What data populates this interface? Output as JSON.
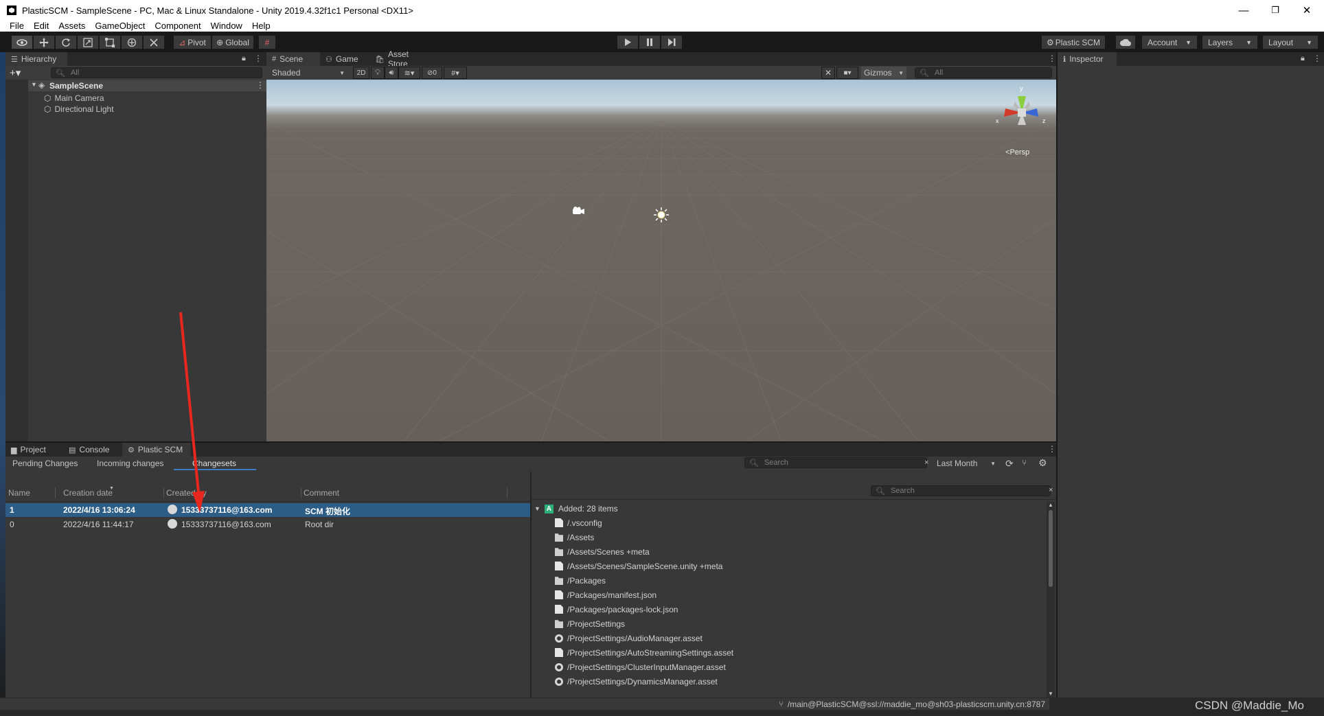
{
  "window": {
    "title": "PlasticSCM - SampleScene - PC, Mac & Linux Standalone - Unity 2019.4.32f1c1 Personal <DX11>",
    "minimize": "—",
    "maximize": "❐",
    "close": "✕"
  },
  "menu": [
    "File",
    "Edit",
    "Assets",
    "GameObject",
    "Component",
    "Window",
    "Help"
  ],
  "toolbar": {
    "pivot": "Pivot",
    "global": "Global",
    "plastic_scm": "Plastic SCM",
    "account": "Account",
    "layers": "Layers",
    "layout": "Layout"
  },
  "hierarchy": {
    "tab": "Hierarchy",
    "search_placeholder": "All",
    "scene": "SampleScene",
    "items": [
      "Main Camera",
      "Directional Light"
    ]
  },
  "scene_view": {
    "tabs": [
      "Scene",
      "Game",
      "Asset Store"
    ],
    "shading": "Shaded",
    "mode_2d": "2D",
    "hidden_count": "0",
    "gizmos": "Gizmos",
    "search_placeholder": "All",
    "persp": "Persp",
    "axes": {
      "x": "x",
      "y": "y",
      "z": "z"
    }
  },
  "inspector": {
    "tab": "Inspector"
  },
  "bottom": {
    "tabs": [
      "Project",
      "Console",
      "Plastic SCM"
    ],
    "subtabs": [
      "Pending Changes",
      "Incoming changes",
      "Changesets"
    ],
    "search_placeholder": "Search",
    "period": "Last Month",
    "columns": [
      "Name",
      "Creation date",
      "Created by",
      "Comment"
    ],
    "changesets": [
      {
        "name": "1",
        "date": "2022/4/16 13:06:24",
        "by": "15333737116@163.com",
        "comment": "SCM 初始化"
      },
      {
        "name": "0",
        "date": "2022/4/16 11:44:17",
        "by": "15333737116@163.com",
        "comment": "Root dir"
      }
    ],
    "details_search_placeholder": "Search",
    "added_badge": "A",
    "added_label": "Added: 28 items",
    "files": [
      {
        "path": "/.vsconfig",
        "icon": "file"
      },
      {
        "path": "/Assets",
        "icon": "folder"
      },
      {
        "path": "/Assets/Scenes +meta",
        "icon": "folder"
      },
      {
        "path": "/Assets/Scenes/SampleScene.unity +meta",
        "icon": "file"
      },
      {
        "path": "/Packages",
        "icon": "folder"
      },
      {
        "path": "/Packages/manifest.json",
        "icon": "file"
      },
      {
        "path": "/Packages/packages-lock.json",
        "icon": "file"
      },
      {
        "path": "/ProjectSettings",
        "icon": "folder"
      },
      {
        "path": "/ProjectSettings/AudioManager.asset",
        "icon": "gear"
      },
      {
        "path": "/ProjectSettings/AutoStreamingSettings.asset",
        "icon": "file"
      },
      {
        "path": "/ProjectSettings/ClusterInputManager.asset",
        "icon": "gear"
      },
      {
        "path": "/ProjectSettings/DynamicsManager.asset",
        "icon": "gear"
      }
    ],
    "branch": "/main@PlasticSCM@ssl://maddie_mo@sh03-plasticscm.unity.cn:8787"
  },
  "watermark": "CSDN @Maddie_Mo",
  "colors": {
    "selection": "#2c5d87",
    "annotation_arrow": "#e8271f",
    "added_badge": "#2db07a"
  }
}
